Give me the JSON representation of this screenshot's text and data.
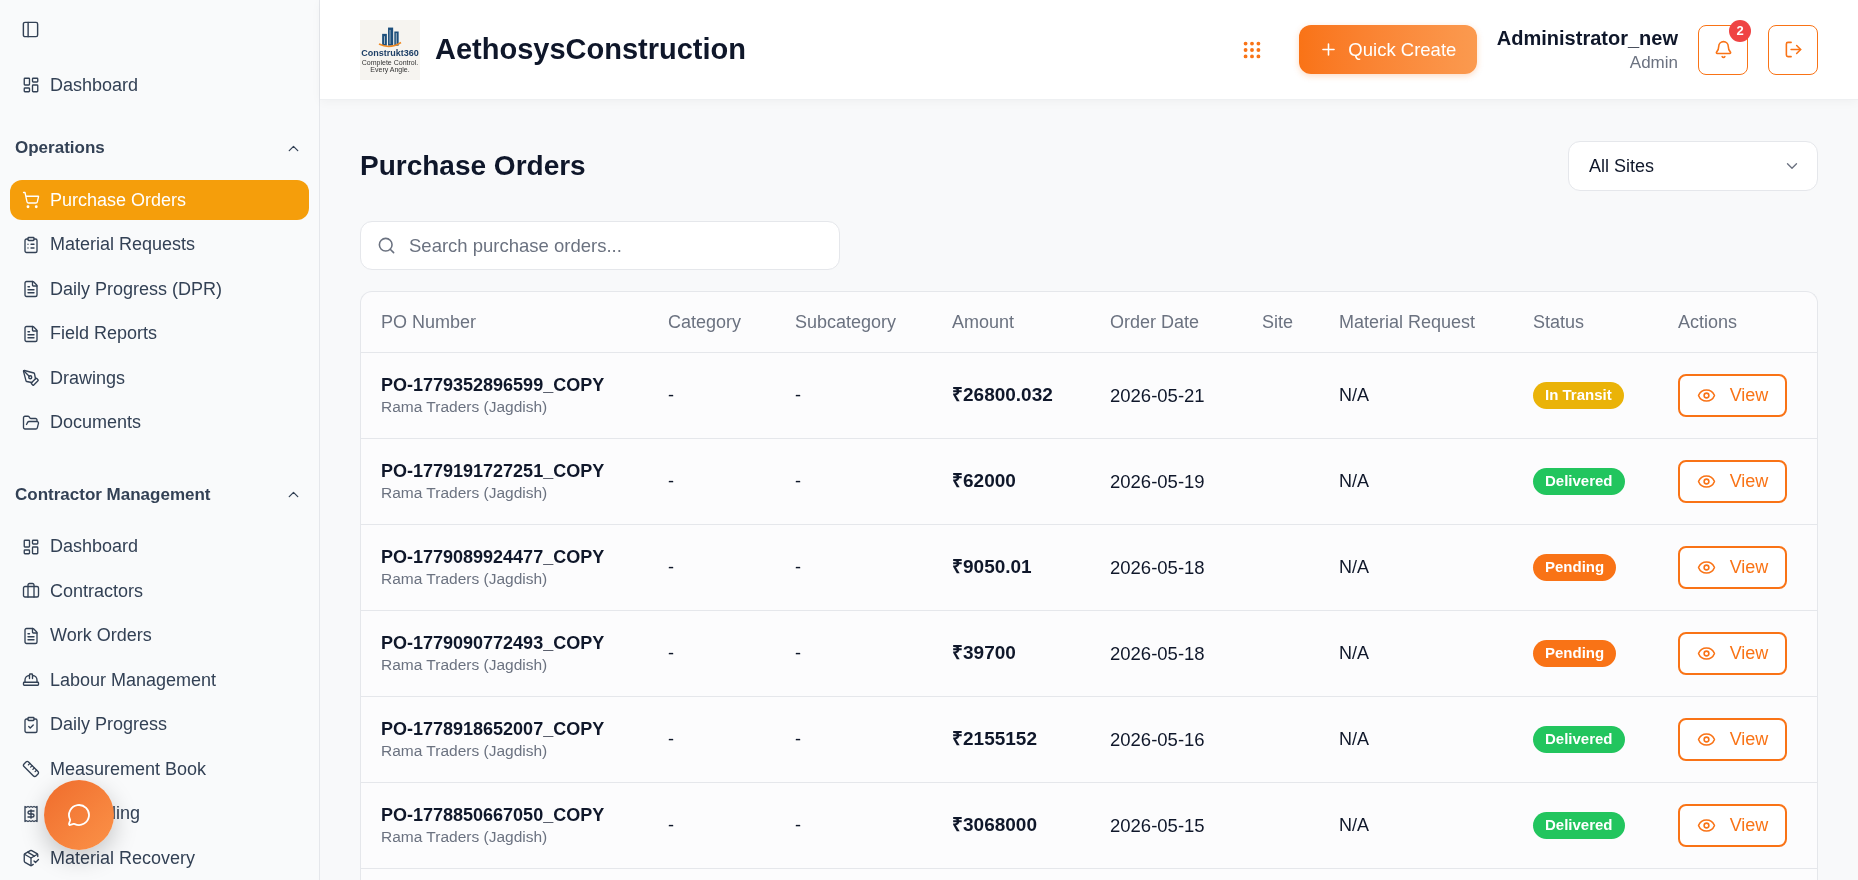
{
  "sidebar": {
    "items": [
      {
        "label": "Dashboard",
        "selected": false
      }
    ],
    "sections": [
      {
        "title": "Operations",
        "expanded": true,
        "items": [
          {
            "label": "Purchase Orders",
            "selected": true,
            "covered": false
          },
          {
            "label": "Material Requests",
            "selected": false,
            "covered": false
          },
          {
            "label": "Daily Progress (DPR)",
            "selected": false,
            "covered": false
          },
          {
            "label": "Field Reports",
            "selected": false,
            "covered": false
          },
          {
            "label": "Drawings",
            "selected": false,
            "covered": false
          },
          {
            "label": "Documents",
            "selected": false,
            "covered": false
          }
        ]
      },
      {
        "title": "Contractor Management",
        "expanded": true,
        "items": [
          {
            "label": "Dashboard",
            "selected": false,
            "covered": false
          },
          {
            "label": "Contractors",
            "selected": false,
            "covered": false
          },
          {
            "label": "Work Orders",
            "selected": false,
            "covered": false
          },
          {
            "label": "Labour Management",
            "selected": false,
            "covered": false
          },
          {
            "label": "Daily Progress",
            "selected": false,
            "covered": false
          },
          {
            "label": "Measurement Book",
            "selected": false,
            "covered": false
          },
          {
            "label": "ling",
            "selected": false,
            "covered": true
          },
          {
            "label": "Material Recovery",
            "selected": false,
            "covered": false
          }
        ]
      }
    ]
  },
  "header": {
    "logo": {
      "name": "Construkt360",
      "tagline": "Complete Control. Every Angle."
    },
    "title": "AethosysConstruction",
    "quick_create": "Quick Create",
    "user": {
      "name": "Administrator_new",
      "role": "Admin"
    },
    "notifications": {
      "count": "2"
    }
  },
  "page": {
    "title": "Purchase Orders",
    "site_filter": {
      "value": "All Sites"
    },
    "search": {
      "placeholder": "Search purchase orders..."
    }
  },
  "table": {
    "columns": [
      "PO Number",
      "Category",
      "Subcategory",
      "Amount",
      "Order Date",
      "Site",
      "Material Request",
      "Status",
      "Actions"
    ],
    "rows": [
      {
        "po_number": "PO-1779352896599_COPY",
        "supplier": "Rama Traders (Jagdish)",
        "category": "-",
        "subcategory": "-",
        "amount": "₹26800.032",
        "order_date": "2026-05-21",
        "material_request": "N/A",
        "status": {
          "label": "In Transit",
          "color": "#eab308"
        },
        "action": "View"
      },
      {
        "po_number": "PO-1779191727251_COPY",
        "supplier": "Rama Traders (Jagdish)",
        "category": "-",
        "subcategory": "-",
        "amount": "₹62000",
        "order_date": "2026-05-19",
        "material_request": "N/A",
        "status": {
          "label": "Delivered",
          "color": "#22c55e"
        },
        "action": "View"
      },
      {
        "po_number": "PO-1779089924477_COPY",
        "supplier": "Rama Traders (Jagdish)",
        "category": "-",
        "subcategory": "-",
        "amount": "₹9050.01",
        "order_date": "2026-05-18",
        "material_request": "N/A",
        "status": {
          "label": "Pending",
          "color": "#f97316"
        },
        "action": "View"
      },
      {
        "po_number": "PO-1779090772493_COPY",
        "supplier": "Rama Traders (Jagdish)",
        "category": "-",
        "subcategory": "-",
        "amount": "₹39700",
        "order_date": "2026-05-18",
        "material_request": "N/A",
        "status": {
          "label": "Pending",
          "color": "#f97316"
        },
        "action": "View"
      },
      {
        "po_number": "PO-1778918652007_COPY",
        "supplier": "Rama Traders (Jagdish)",
        "category": "-",
        "subcategory": "-",
        "amount": "₹2155152",
        "order_date": "2026-05-16",
        "material_request": "N/A",
        "status": {
          "label": "Delivered",
          "color": "#22c55e"
        },
        "action": "View"
      },
      {
        "po_number": "PO-1778850667050_COPY",
        "supplier": "Rama Traders (Jagdish)",
        "category": "-",
        "subcategory": "-",
        "amount": "₹3068000",
        "order_date": "2026-05-15",
        "material_request": "N/A",
        "status": {
          "label": "Delivered",
          "color": "#22c55e"
        },
        "action": "View"
      }
    ]
  }
}
